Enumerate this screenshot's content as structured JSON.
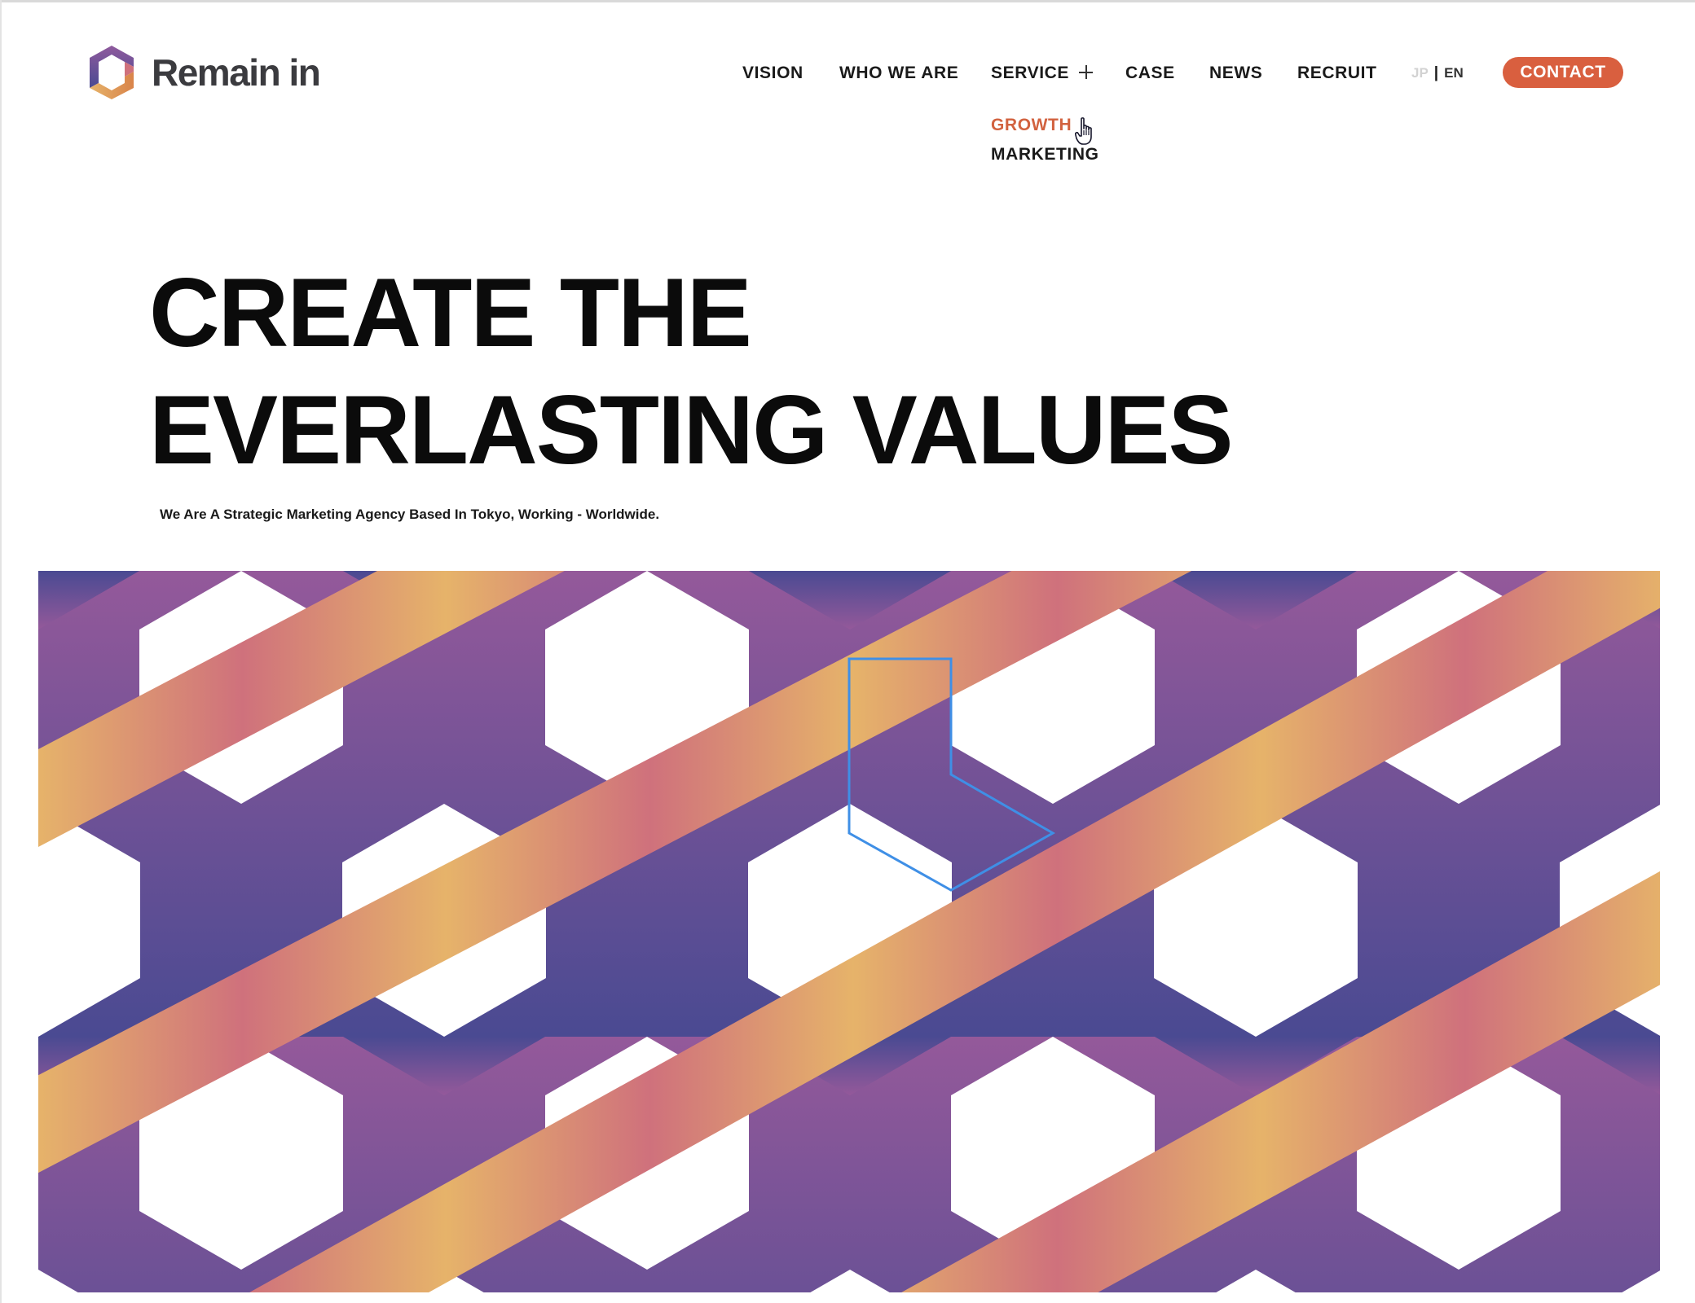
{
  "brand": {
    "name": "Remain in",
    "colors": {
      "accent_orange": "#d95f3f",
      "purple_dark": "#4a4a92",
      "purple_light": "#8f5a9d",
      "ribbon_gold": "#e6b36a",
      "ribbon_rose": "#cf717c",
      "selection_blue": "#3f8fe6"
    }
  },
  "nav": {
    "items": [
      {
        "label": "VISION"
      },
      {
        "label": "WHO WE ARE"
      },
      {
        "label": "SERVICE",
        "icon": "plus-icon"
      },
      {
        "label": "CASE"
      },
      {
        "label": "NEWS"
      },
      {
        "label": "RECRUIT"
      }
    ],
    "lang": {
      "jp": "JP",
      "separator": "|",
      "en": "EN",
      "active": "EN"
    },
    "contact_label": "CONTACT"
  },
  "service_dropdown": {
    "items": [
      {
        "label": "GROWTH",
        "hovered": true
      },
      {
        "label": "MARKETING"
      }
    ],
    "pointer_icon": "hand-pointer-icon"
  },
  "hero": {
    "title_line1": "CREATE THE",
    "title_line2": "EVERLASTING  VALUES",
    "tagline": "We Are A Strategic Marketing Agency Based In Tokyo, Working - Worldwide."
  },
  "pattern": {
    "icon": "hexagon-ribbon-pattern",
    "highlighted_segment": true
  }
}
